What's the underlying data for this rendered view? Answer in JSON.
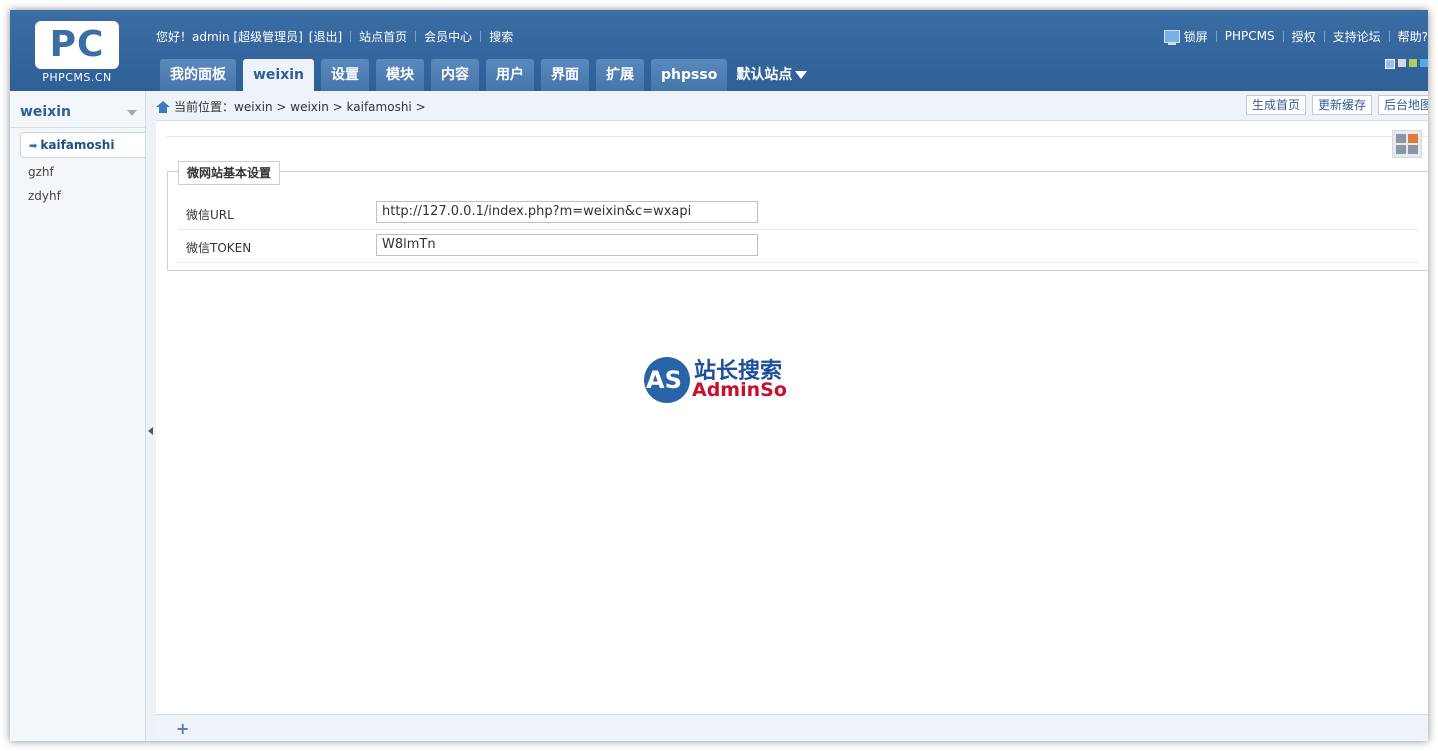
{
  "logo": {
    "letters": "PC",
    "sub": "PHPCMS.CN"
  },
  "topbar": {
    "greeting": "您好！admin [超级管理员]",
    "logout": "[退出]",
    "links": [
      "站点首页",
      "会员中心",
      "搜索"
    ]
  },
  "topright": {
    "lock": "锁屏",
    "links": [
      "PHPCMS",
      "授权",
      "支持论坛",
      "帮助?"
    ]
  },
  "tabs": [
    "我的面板",
    "weixin",
    "设置",
    "模块",
    "内容",
    "用户",
    "界面",
    "扩展",
    "phpsso"
  ],
  "site_switch": "默认站点",
  "sidebar": {
    "title": "weixin",
    "items": [
      "kaifamoshi",
      "gzhf",
      "zdyhf"
    ]
  },
  "breadcrumb": {
    "label": "当前位置：",
    "path": "weixin > weixin > kaifamoshi >"
  },
  "crumb_buttons": [
    "生成首页",
    "更新缓存",
    "后台地图"
  ],
  "form": {
    "legend": "微网站基本设置",
    "rows": [
      {
        "label": "微信URL",
        "value": "http://127.0.0.1/index.php?m=weixin&c=wxapi"
      },
      {
        "label": "微信TOKEN",
        "value": "W8lmTn"
      }
    ]
  },
  "watermark": {
    "circle": "AS",
    "cn": "站长搜索",
    "en": "AdminSo"
  },
  "footer": {
    "plus": "+"
  },
  "colors": {
    "header": "#3b6ea5",
    "accent": "#2f5f97",
    "brand_red": "#c8102e"
  }
}
